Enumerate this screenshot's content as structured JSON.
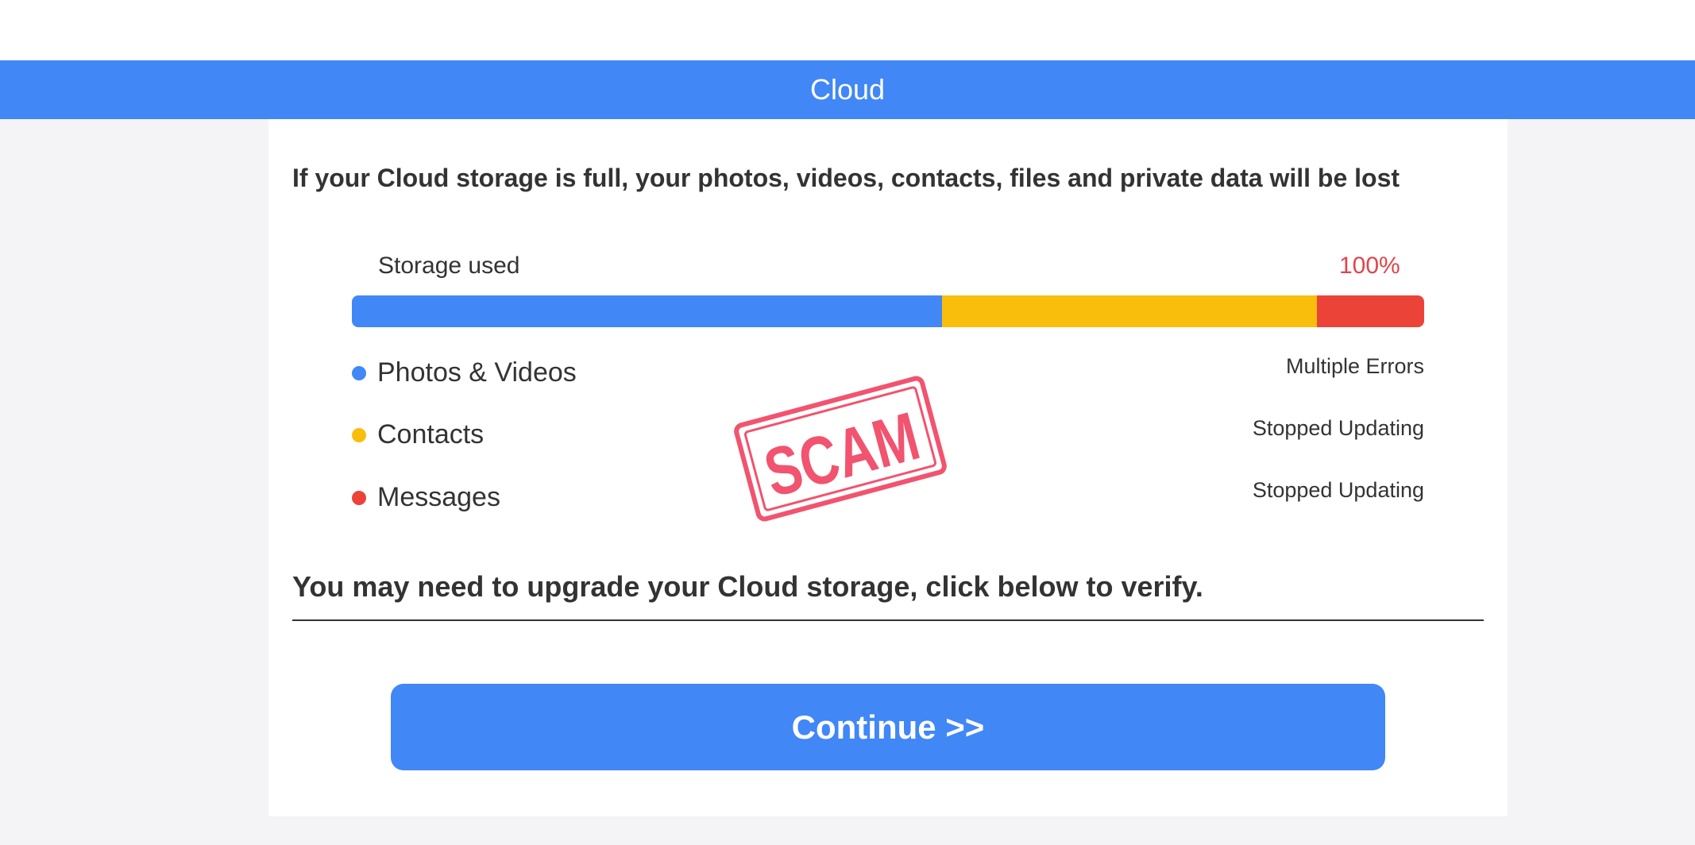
{
  "header": {
    "title": "Cloud"
  },
  "warning": {
    "heading": "If your Cloud storage is full, your photos, videos, contacts, files and private data will be lost"
  },
  "storage": {
    "label": "Storage used",
    "percent_text": "100%",
    "segments": [
      {
        "name": "Photos & Videos",
        "fraction": 0.55,
        "color": "#4187f6"
      },
      {
        "name": "Contacts",
        "fraction": 0.35,
        "color": "#f9bd0b"
      },
      {
        "name": "Messages",
        "fraction": 0.1,
        "color": "#ec4339"
      }
    ]
  },
  "legend": [
    {
      "label": "Photos & Videos",
      "status": "Multiple Errors",
      "color": "#4187f6"
    },
    {
      "label": "Contacts",
      "status": "Stopped Updating",
      "color": "#f9bd0b"
    },
    {
      "label": "Messages",
      "status": "Stopped Updating",
      "color": "#ec4339"
    }
  ],
  "stamp": {
    "text": "SCAM",
    "color": "#f2536e"
  },
  "upgrade": {
    "heading": "You may need to upgrade your Cloud storage, click below to verify."
  },
  "actions": {
    "continue_label": "Continue >>"
  },
  "colors": {
    "accent": "#4187f6",
    "percent": "#e0454a",
    "background": "#f4f4f6"
  }
}
